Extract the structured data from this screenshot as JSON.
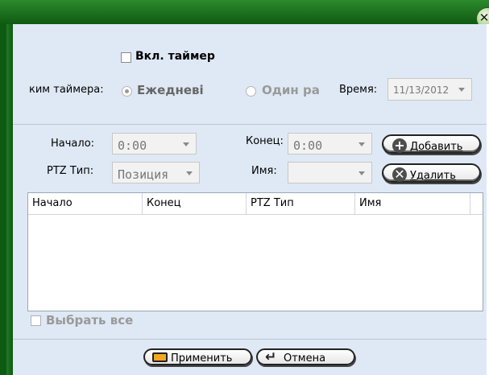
{
  "window": {
    "close_glyph": "✕"
  },
  "timer": {
    "enable_label": "Вкл. таймер",
    "mode_label": "ким таймера:",
    "daily_label": "Ежедневі",
    "once_label": "Один ра",
    "time_label": "Время:",
    "date_value": "11/13/2012"
  },
  "schedule": {
    "start_label": "Начало:",
    "start_value": "0:00",
    "end_label": "Конец:",
    "end_value": "0:00",
    "type_label": "PTZ Тип:",
    "type_value": "Позиция",
    "name_label": "Имя:",
    "name_value": "",
    "add_label": "Добавить",
    "delete_label": "Удалить"
  },
  "table": {
    "columns": [
      "Начало",
      "Конец",
      "PTZ Тип",
      "Имя"
    ]
  },
  "select_all_label": "Выбрать все",
  "footer": {
    "apply_label": "Применить",
    "cancel_label": "Отмена"
  },
  "icons": [
    "close-icon",
    "plus-icon",
    "x-icon",
    "apply-icon",
    "undo-arrow-icon"
  ]
}
